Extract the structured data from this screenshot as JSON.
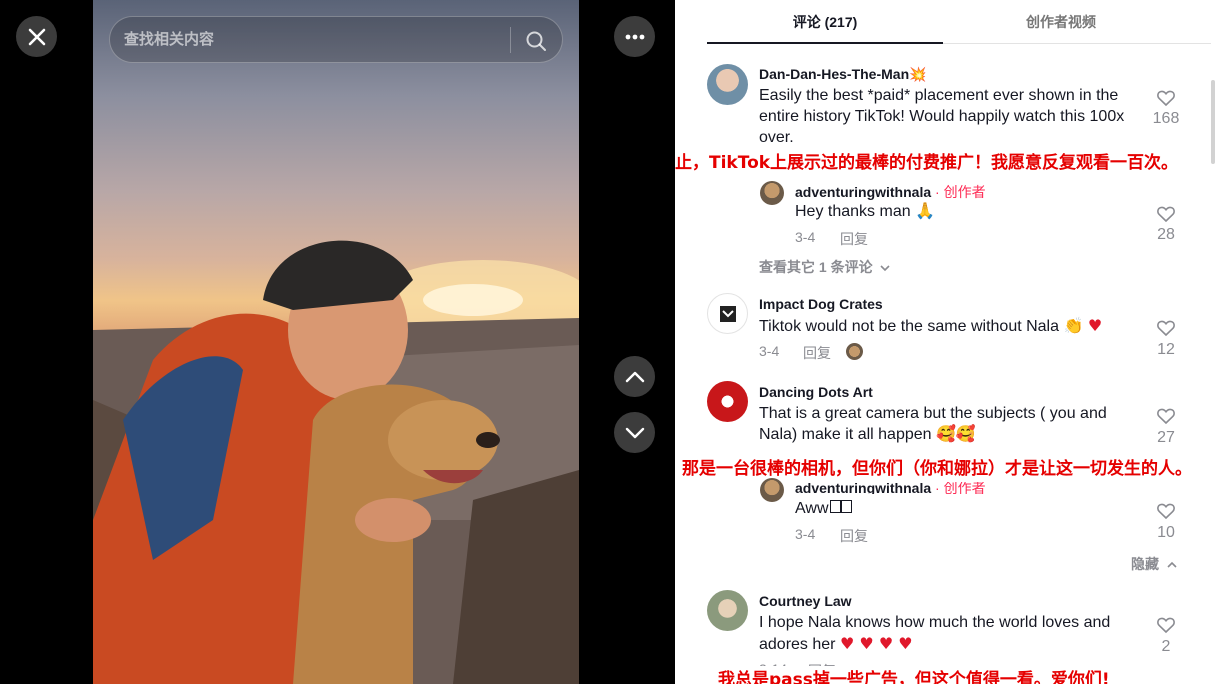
{
  "search": {
    "placeholder": "查找相关内容"
  },
  "tabs": {
    "comments": "评论 (217)",
    "creator_videos": "创作者视频"
  },
  "comments": [
    {
      "username": "Dan-Dan-Hes-The-Man💥",
      "text": "Easily the best *paid* placement ever shown in the entire history TikTok! Would happily watch this 100x over.",
      "likes": "168",
      "translation": "迄今为止，TikTok上展示过的最棒的付费推广！我愿意反复观看一百次。",
      "reply": {
        "username": "adventuringwithnala",
        "creator_tag": "· 创作者",
        "text": "Hey thanks man 🙏",
        "date": "3-4",
        "reply_label": "回复",
        "likes": "28"
      },
      "view_more": "查看其它 1 条评论"
    },
    {
      "username": "Impact Dog Crates",
      "text": "Tiktok would not be the same without Nala 👏",
      "date": "3-4",
      "reply_label": "回复",
      "likes": "12"
    },
    {
      "username": "Dancing Dots Art",
      "text": "That is a great camera but the subjects ( you and Nala) make it all happen 🥰🥰",
      "likes": "27",
      "translation": "那是一台很棒的相机，但你们（你和娜拉）才是让这一切发生的人。",
      "reply": {
        "username": "adventuringwithnala",
        "creator_tag": "· 创作者",
        "text": "Aww",
        "date": "3-4",
        "reply_label": "回复",
        "likes": "10"
      },
      "hide_label": "隐藏"
    },
    {
      "username": "Courtney Law",
      "text": "I hope Nala knows how much the world loves and adores her",
      "hearts": "♥ ♥ ♥ ♥",
      "date": "3-14",
      "reply_label": "回复",
      "likes": "2",
      "translation": "我总是pass掉一些广告，但这个值得一看。爱你们!"
    }
  ],
  "colors": {
    "accent": "#fe2c55",
    "translation_red": "#e50000",
    "text": "#161823",
    "muted": "#8a8b91"
  }
}
